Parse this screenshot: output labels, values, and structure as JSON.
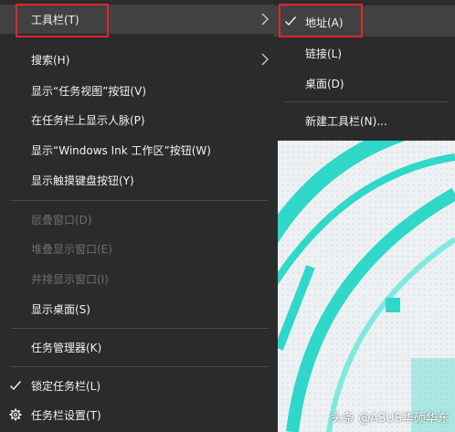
{
  "menu": {
    "toolbar": "工具栏(T)",
    "search": "搜索(H)",
    "task_view": "显示“任务视图”按钮(V)",
    "people": "在任务栏上显示人脉(P)",
    "ink": "显示“Windows Ink 工作区”按钮(W)",
    "touch_keyboard": "显示触摸键盘按钮(Y)",
    "cascade": "层叠窗口(D)",
    "stacked": "堆叠显示窗口(E)",
    "side_by_side": "并排显示窗口(I)",
    "show_desktop": "显示桌面(S)",
    "task_manager": "任务管理器(K)",
    "lock_taskbar": "锁定任务栏(L)",
    "settings": "任务栏设置(T)"
  },
  "submenu": {
    "address": "地址(A)",
    "links": "链接(L)",
    "desktop": "桌面(D)",
    "new_toolbar": "新建工具栏(N)..."
  },
  "watermark": "头条 @ASUS华硕华东",
  "colors": {
    "menu_bg": "#2b2b2b",
    "hover_bg": "#414141",
    "highlight": "#e0262b",
    "accent_teal": "#2fd8c8"
  },
  "icons": [
    "chevron-right-icon",
    "check-icon",
    "gear-icon"
  ]
}
